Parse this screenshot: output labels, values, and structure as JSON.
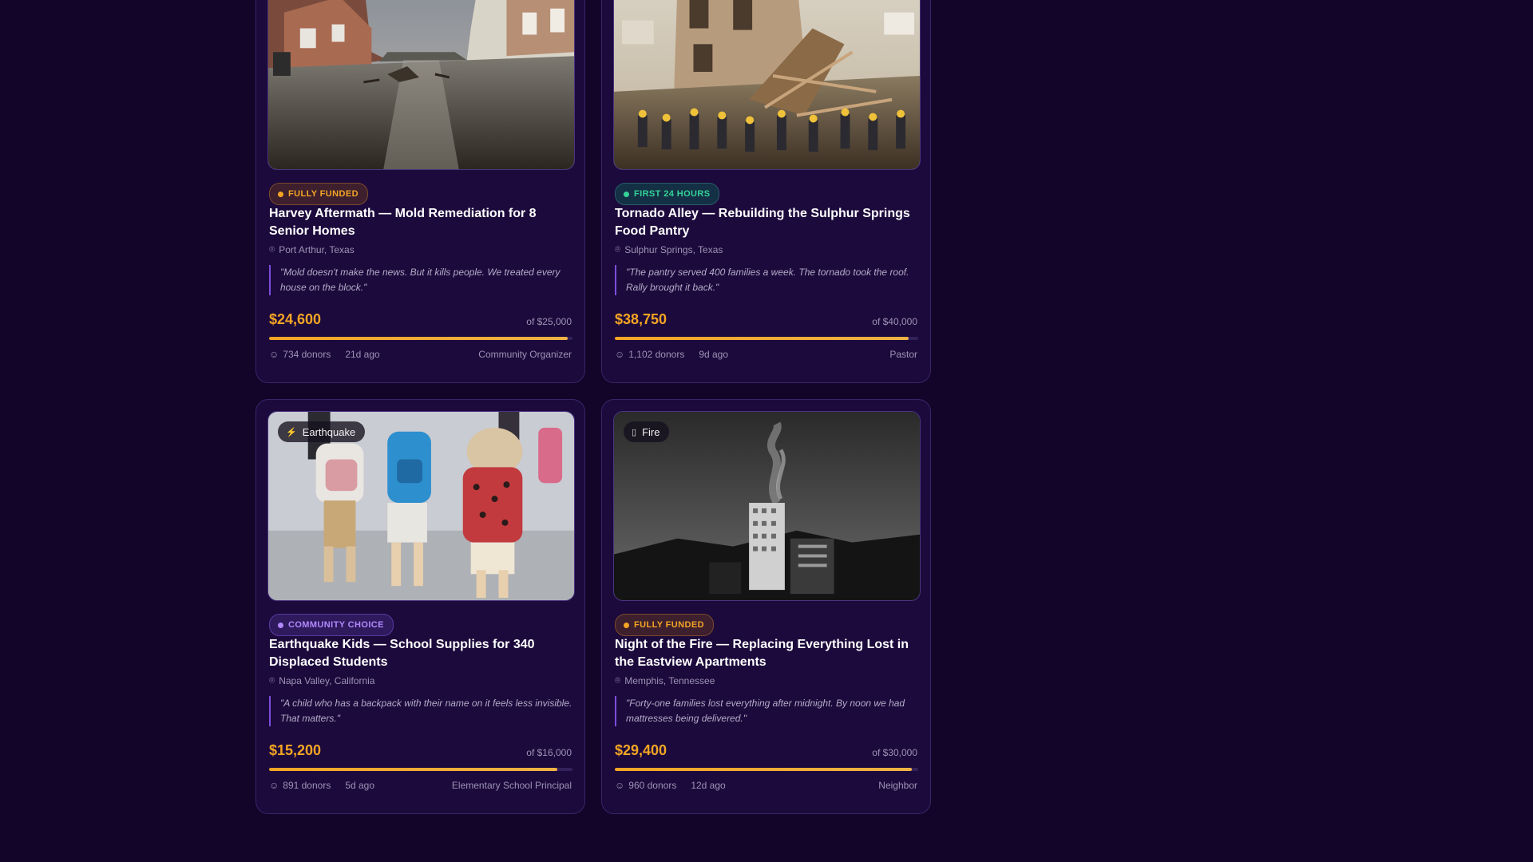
{
  "cards": [
    {
      "category": "",
      "category_icon": "",
      "image": "flooded-street-photo",
      "status": "FULLY FUNDED",
      "status_color": "#f5a524",
      "status_bg": "#3d1f2e",
      "status_border": "#7a4a2a",
      "title": "Harvey Aftermath — Mold Remediation for 8 Senior Homes",
      "location": "Port Arthur, Texas",
      "quote": "\"Mold doesn't make the news. But it kills people. We treated every house on the block.\"",
      "raised": "$24,600",
      "goal": "of $25,000",
      "progress": 0.984,
      "donors": "734 donors",
      "ago": "21d ago",
      "organizer": "Community Organizer"
    },
    {
      "category": "",
      "category_icon": "",
      "image": "tornado-debris-photo",
      "status": "FIRST 24 HOURS",
      "status_color": "#34d399",
      "status_bg": "#143044",
      "status_border": "#2a5a6a",
      "title": "Tornado Alley — Rebuilding the Sulphur Springs Food Pantry",
      "location": "Sulphur Springs, Texas",
      "quote": "\"The pantry served 400 families a week. The tornado took the roof. Rally brought it back.\"",
      "raised": "$38,750",
      "goal": "of $40,000",
      "progress": 0.969,
      "donors": "1,102 donors",
      "ago": "9d ago",
      "organizer": "Pastor"
    },
    {
      "category": "Earthquake",
      "category_icon": "⚡",
      "image": "school-kids-backpacks-photo",
      "status": "COMMUNITY CHOICE",
      "status_color": "#b388ff",
      "status_bg": "#2e1a5c",
      "status_border": "#5a3aa0",
      "title": "Earthquake Kids — School Supplies for 340 Displaced Students",
      "location": "Napa Valley, California",
      "quote": "\"A child who has a backpack with their name on it feels less invisible. That matters.\"",
      "raised": "$15,200",
      "goal": "of $16,000",
      "progress": 0.95,
      "donors": "891 donors",
      "ago": "5d ago",
      "organizer": "Elementary School Principal"
    },
    {
      "category": "Fire",
      "category_icon": "▯",
      "image": "burning-apartment-photo",
      "status": "FULLY FUNDED",
      "status_color": "#f5a524",
      "status_bg": "#3d1f2e",
      "status_border": "#7a4a2a",
      "title": "Night of the Fire — Replacing Everything Lost in the Eastview Apartments",
      "location": "Memphis, Tennessee",
      "quote": "\"Forty-one families lost everything after midnight. By noon we had mattresses being delivered.\"",
      "raised": "$29,400",
      "goal": "of $30,000",
      "progress": 0.98,
      "donors": "960 donors",
      "ago": "12d ago",
      "organizer": "Neighbor"
    }
  ]
}
